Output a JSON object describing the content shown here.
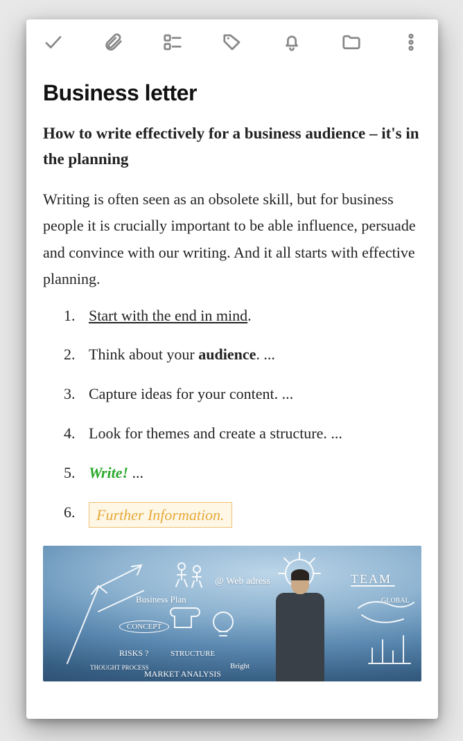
{
  "note": {
    "title": "Business letter",
    "subtitle": "How to write effectively for a business audience – it's in the planning",
    "paragraph": "Writing is often seen as an obsolete skill, but for business people it is crucially important to be able influence, persuade and convince with our writing. And it all starts with effective planning.",
    "steps": {
      "1": {
        "prefix": "",
        "link": "Start with the end in mind",
        "suffix": "."
      },
      "2": {
        "prefix": "Think about your ",
        "bold": "audience",
        "suffix": ". ..."
      },
      "3": {
        "text": "Capture ideas for your content. ..."
      },
      "4": {
        "text": "Look for themes and create a structure. ..."
      },
      "5": {
        "green": "Write!",
        "suffix": " ..."
      },
      "6": {
        "box": "Further Information."
      }
    }
  },
  "image_doodles": {
    "bp": "Business Plan",
    "concept": "CONCEPT",
    "risks": "RISKS ?",
    "structure": "STRUCTURE",
    "tp": "THOUGHT\nPROCESS",
    "ma": "MARKET ANALYSIS",
    "web": "@ Web adress",
    "bright": "Bright",
    "team": "TEAM",
    "global": "GLOBAL"
  },
  "toolbar_icons": [
    "check",
    "paperclip",
    "checklist",
    "tag",
    "bell",
    "folder",
    "more"
  ]
}
